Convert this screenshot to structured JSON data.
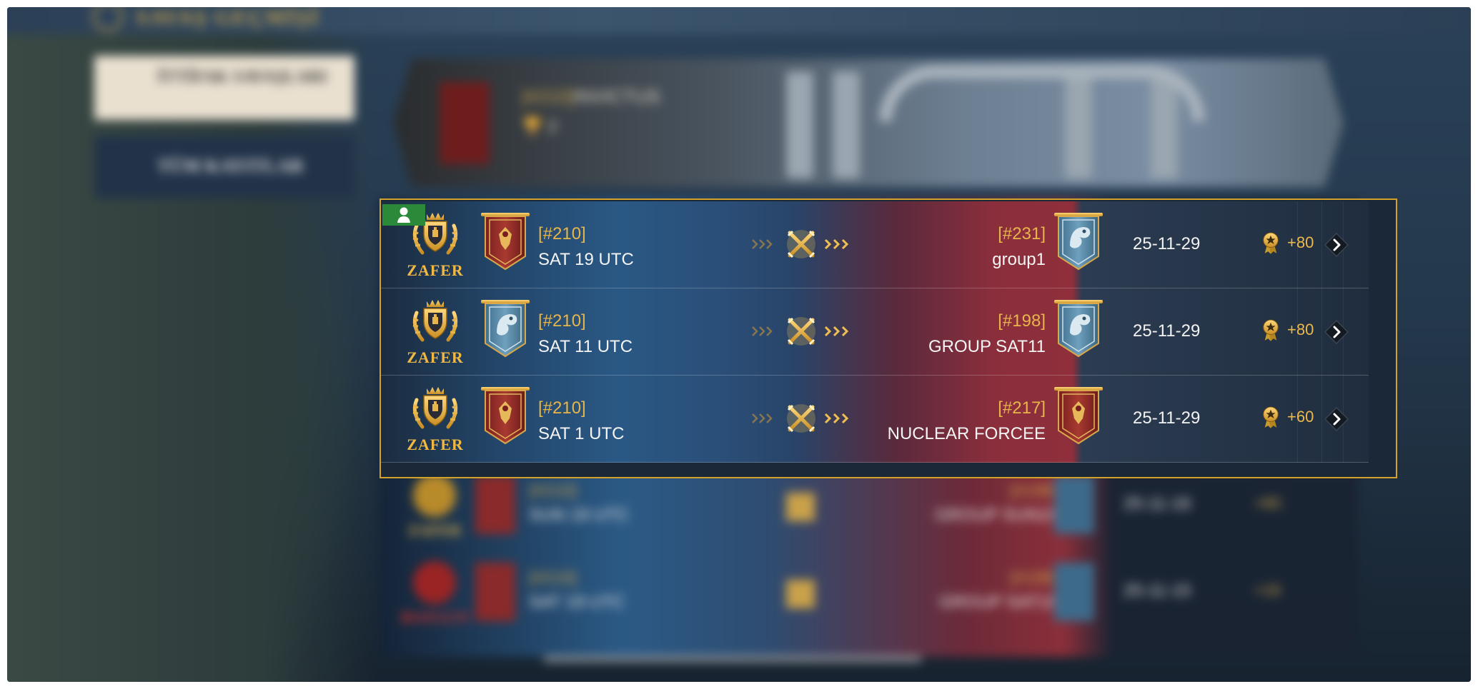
{
  "header": {
    "title": "SAVAŞ GEÇMİŞİ"
  },
  "sidebar": {
    "alliance_wars_label": "İTTİFAK SAVAŞLARI",
    "filter_label": "TÜM KAYITLAR"
  },
  "alliance": {
    "tag": "[#210]",
    "name": "INVICTUS",
    "trophies": "2"
  },
  "battles": [
    {
      "result": "ZAFER",
      "own_tag": "[#210]",
      "own_name": "SAT 19 UTC",
      "opp_tag": "[#231]",
      "opp_name": "group1",
      "date": "25-11-29",
      "points": "+80",
      "own_banner": "red-banner",
      "opp_banner": "blue-banner"
    },
    {
      "result": "ZAFER",
      "own_tag": "[#210]",
      "own_name": "SAT 11 UTC",
      "opp_tag": "[#198]",
      "opp_name": "GROUP SAT11",
      "date": "25-11-29",
      "points": "+80",
      "own_banner": "blue-banner",
      "opp_banner": "blue-banner"
    },
    {
      "result": "ZAFER",
      "own_tag": "[#210]",
      "own_name": "SAT 1 UTC",
      "opp_tag": "[#217]",
      "opp_name": "NUCLEAR FORCEE",
      "date": "25-11-29",
      "points": "+60",
      "own_banner": "red-banner",
      "opp_banner": "red-banner"
    }
  ],
  "blurred_battles": [
    {
      "result": "ZAFER",
      "own_tag": "[#210]",
      "own_name": "SUN 19 UTC",
      "opp_tag": "[#198]",
      "opp_name": "GROUP SUN19",
      "date": "25-11-16",
      "points": "+80"
    },
    {
      "result": "BOZGUN",
      "own_tag": "[#210]",
      "own_name": "SAT 19 UTC",
      "opp_tag": "[#198]",
      "opp_name": "GROUP SAT19",
      "date": "25-11-15",
      "points": "+16"
    }
  ],
  "colors": {
    "gold": "#e7b54a",
    "highlight_border": "#d4a12a",
    "player_badge": "#2a8a3a"
  }
}
